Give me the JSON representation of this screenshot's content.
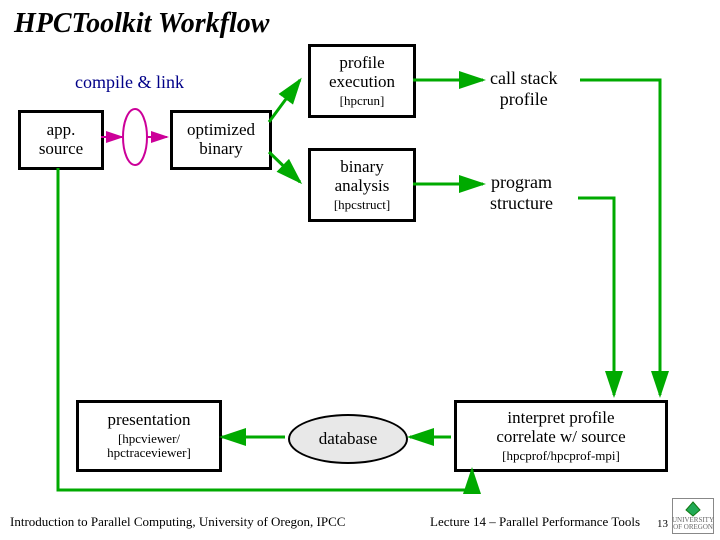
{
  "title": "HPCToolkit Workflow",
  "labels": {
    "compile": "compile & link",
    "callstack": "call stack\nprofile",
    "progstruct": "program\nstructure"
  },
  "nodes": {
    "appsource": "app.\nsource",
    "optbinary": "optimized\nbinary",
    "profexec": "profile\nexecution",
    "profexec_sub": "[hpcrun]",
    "binanal": "binary\nanalysis",
    "binanal_sub": "[hpcstruct]",
    "presentation": "presentation",
    "presentation_sub": "[hpcviewer/\nhpctraceviewer]",
    "database": "database",
    "interp": "interpret profile\ncorrelate w/ source",
    "interp_sub": "[hpcprof/hpcprof-mpi]"
  },
  "footer": {
    "left": "Introduction to Parallel Computing, University of Oregon, IPCC",
    "right": "Lecture 14 – Parallel Performance Tools",
    "page": "13",
    "logo": "UNIVERSITY\nOF OREGON"
  }
}
